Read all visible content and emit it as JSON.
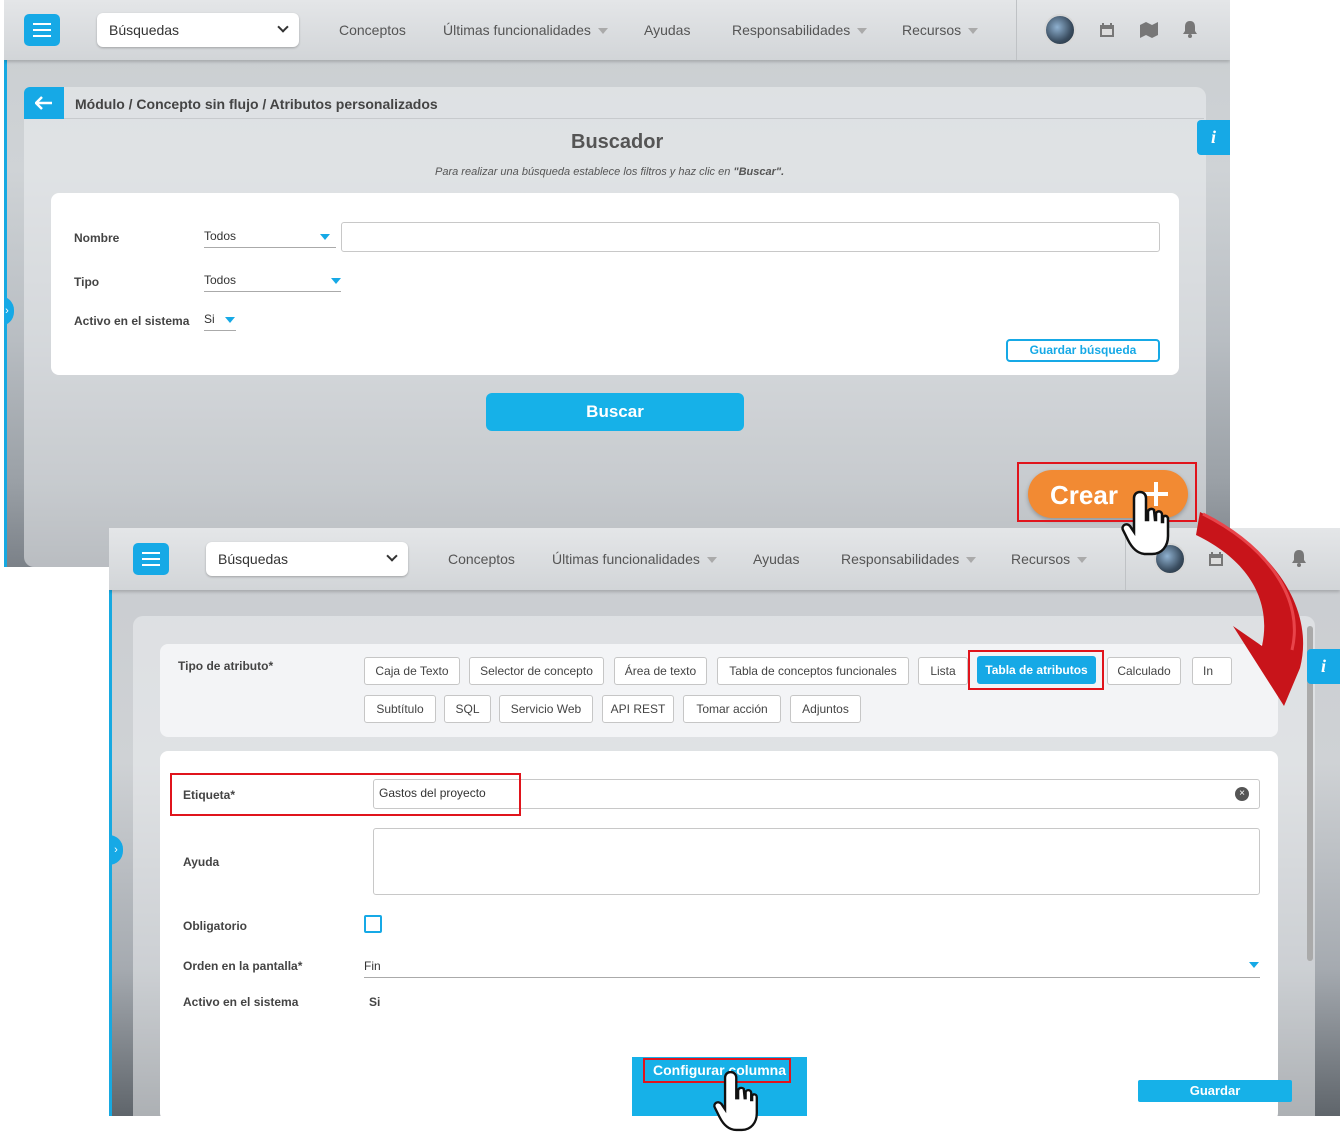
{
  "topbar": {
    "search_value": "Búsquedas",
    "nav_conceptos": "Conceptos",
    "nav_ultimas": "Últimas funcionalidades",
    "nav_ayudas": "Ayudas",
    "nav_responsabilidades": "Responsabilidades",
    "nav_recursos": "Recursos"
  },
  "breadcrumb": "Módulo / Concepto sin flujo / Atributos personalizados",
  "buscador": {
    "title": "Buscador",
    "hint_prefix": "Para realizar una búsqueda establece los filtros y haz clic en ",
    "hint_bold": "\"Buscar\".",
    "nombre_label": "Nombre",
    "nombre_value": "Todos",
    "tipo_label": "Tipo",
    "tipo_value": "Todos",
    "activo_label": "Activo en el sistema",
    "activo_value": "Si",
    "guardar_busqueda": "Guardar búsqueda",
    "buscar": "Buscar",
    "crear": "Crear"
  },
  "info_label": "i",
  "form": {
    "tipo_label": "Tipo de atributo*",
    "chips_row1": [
      "Caja de Texto",
      "Selector de concepto",
      "Área de texto",
      "Tabla de conceptos funcionales",
      "Lista",
      "Tabla de atributos",
      "Calculado",
      "In"
    ],
    "chips_row2": [
      "Subtítulo",
      "SQL",
      "Servicio Web",
      "API REST",
      "Tomar acción",
      "Adjuntos"
    ],
    "etiqueta_label": "Etiqueta*",
    "etiqueta_value": "Gastos del proyecto",
    "ayuda_label": "Ayuda",
    "obligatorio_label": "Obligatorio",
    "orden_label": "Orden en la pantalla*",
    "orden_value": "Fin",
    "activo_label": "Activo en el sistema",
    "activo_value": "Si",
    "configurar": "Configurar columna",
    "guardar": "Guardar"
  },
  "colors": {
    "accent": "#16a9e6",
    "crear": "#f28a33",
    "highlight": "#e0141c",
    "arrow": "#c8141a"
  }
}
